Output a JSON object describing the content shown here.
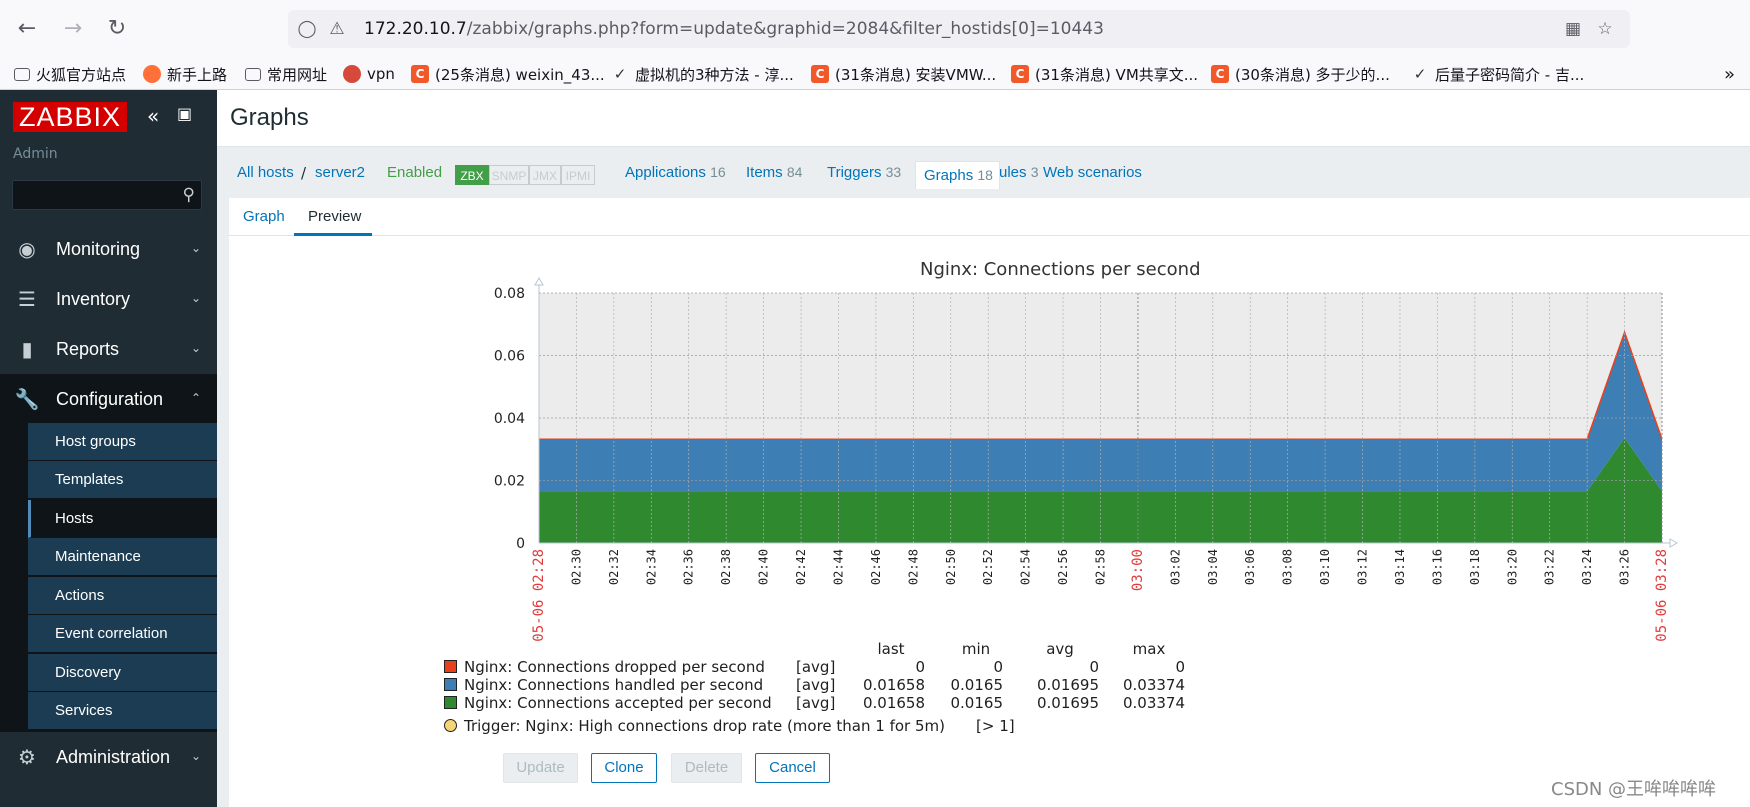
{
  "browser": {
    "url_host": "172.20.10.7",
    "url_path": "/zabbix/graphs.php?form=update&graphid=2084&filter_hostids[0]=10443",
    "bookmarks": [
      "火狐官方站点",
      "新手上路",
      "常用网址",
      "vpn",
      "(25条消息) weixin_43...",
      "虚拟机的3种方法 - 淳...",
      "(31条消息) 安装VMW...",
      "(31条消息) VM共享文...",
      "(30条消息) 多于少的...",
      "后量子密码简介 - 吉..."
    ]
  },
  "sidebar": {
    "logo": "ZABBIX",
    "user": "Admin",
    "menu": [
      {
        "label": "Monitoring",
        "icon": "eye-icon"
      },
      {
        "label": "Inventory",
        "icon": "list-icon"
      },
      {
        "label": "Reports",
        "icon": "bar-chart-icon"
      },
      {
        "label": "Configuration",
        "icon": "wrench-icon"
      },
      {
        "label": "Administration",
        "icon": "gear-icon"
      }
    ],
    "submenu": [
      "Host groups",
      "Templates",
      "Hosts",
      "Maintenance",
      "Actions",
      "Event correlation",
      "Discovery",
      "Services"
    ]
  },
  "page": {
    "title": "Graphs"
  },
  "hostnav": {
    "all_hosts": "All hosts",
    "separator": "/",
    "host": "server2",
    "status": "Enabled",
    "availability": [
      "ZBX",
      "SNMP",
      "JMX",
      "IPMI"
    ],
    "applications": "Applications",
    "applications_count": "16",
    "items": "Items",
    "items_count": "84",
    "triggers": "Triggers",
    "triggers_count": "33",
    "graphs": "Graphs",
    "graphs_count": "18",
    "discovery": "Discovery rules",
    "discovery_count": "3",
    "web": "Web scenarios"
  },
  "tabs": [
    "Graph",
    "Preview"
  ],
  "chart_data": {
    "type": "area",
    "title": "Nginx: Connections per second",
    "ylim": [
      0,
      0.08
    ],
    "yticks": [
      "0.08",
      "0.06",
      "0.04",
      "0.02",
      "0"
    ],
    "xtick_labels": [
      "05-06 02:28",
      "02:30",
      "02:32",
      "02:34",
      "02:36",
      "02:38",
      "02:40",
      "02:42",
      "02:44",
      "02:46",
      "02:48",
      "02:50",
      "02:52",
      "02:54",
      "02:56",
      "02:58",
      "03:00",
      "03:02",
      "03:04",
      "03:06",
      "03:08",
      "03:10",
      "03:12",
      "03:14",
      "03:16",
      "03:18",
      "03:20",
      "03:22",
      "03:24",
      "03:26",
      "05-06 03:28"
    ],
    "highlight_ticks": [
      "05-06 02:28",
      "03:00",
      "05-06 03:28"
    ],
    "stacked": true,
    "series": [
      {
        "name": "Nginx: Connections accepted per second",
        "color": "#2f8a2f",
        "values": [
          0.0166,
          0.0166,
          0.0166,
          0.0166,
          0.0166,
          0.0166,
          0.0166,
          0.0166,
          0.0166,
          0.0166,
          0.0166,
          0.0166,
          0.0166,
          0.0166,
          0.0166,
          0.0166,
          0.0166,
          0.0166,
          0.0166,
          0.0166,
          0.0166,
          0.0166,
          0.0166,
          0.0166,
          0.0166,
          0.0166,
          0.0166,
          0.0166,
          0.0166,
          0.0337,
          0.0166
        ]
      },
      {
        "name": "Nginx: Connections handled per second",
        "color": "#3d7fb4",
        "values": [
          0.0166,
          0.0166,
          0.0166,
          0.0166,
          0.0166,
          0.0166,
          0.0166,
          0.0166,
          0.0166,
          0.0166,
          0.0166,
          0.0166,
          0.0166,
          0.0166,
          0.0166,
          0.0166,
          0.0166,
          0.0166,
          0.0166,
          0.0166,
          0.0166,
          0.0166,
          0.0166,
          0.0166,
          0.0166,
          0.0166,
          0.0166,
          0.0166,
          0.0166,
          0.0337,
          0.0166
        ]
      },
      {
        "name": "Nginx: Connections dropped per second",
        "color": "#e8401c",
        "values": [
          0,
          0,
          0,
          0,
          0,
          0,
          0,
          0,
          0,
          0,
          0,
          0,
          0,
          0,
          0,
          0,
          0,
          0,
          0,
          0,
          0,
          0,
          0,
          0,
          0,
          0,
          0,
          0,
          0,
          0,
          0
        ]
      }
    ],
    "legend": {
      "headers": [
        "last",
        "min",
        "avg",
        "max"
      ],
      "rows": [
        {
          "name": "Nginx: Connections dropped per second",
          "fn": "[avg]",
          "color": "#e8401c",
          "last": "0",
          "min": "0",
          "avg": "0",
          "max": "0"
        },
        {
          "name": "Nginx: Connections handled per second",
          "fn": "[avg]",
          "color": "#3d7fb4",
          "last": "0.01658",
          "min": "0.0165",
          "avg": "0.01695",
          "max": "0.03374"
        },
        {
          "name": "Nginx: Connections accepted per second",
          "fn": "[avg]",
          "color": "#2f8a2f",
          "last": "0.01658",
          "min": "0.0165",
          "avg": "0.01695",
          "max": "0.03374"
        }
      ],
      "trigger": "Trigger: Nginx: High connections drop rate (more than 1 for 5m)",
      "trigger_expr": "[> 1]"
    }
  },
  "buttons": {
    "update": "Update",
    "clone": "Clone",
    "delete": "Delete",
    "cancel": "Cancel"
  },
  "watermark": "CSDN @王哞哞哞哞"
}
